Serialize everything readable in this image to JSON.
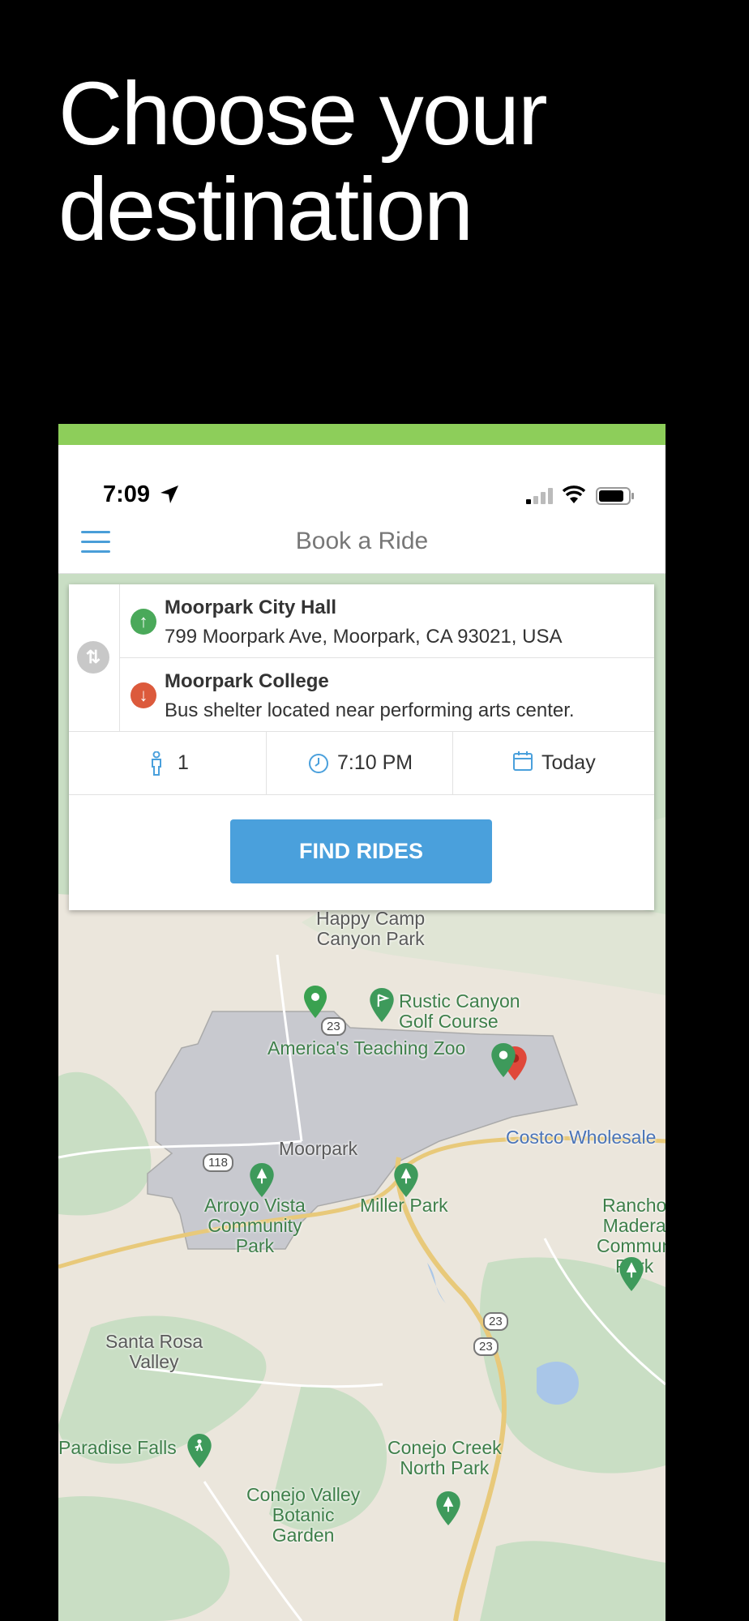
{
  "headline": {
    "line1": "Choose your",
    "line2": "destination"
  },
  "status_bar": {
    "time": "7:09"
  },
  "navbar": {
    "title": "Book a Ride"
  },
  "origin": {
    "name": "Moorpark City Hall",
    "address": "799 Moorpark Ave, Moorpark, CA 93021, USA"
  },
  "destination": {
    "name": "Moorpark College",
    "address": "Bus shelter located near performing arts center."
  },
  "options": {
    "passengers": "1",
    "time": "7:10 PM",
    "date": "Today"
  },
  "find_button": "FIND RIDES",
  "map": {
    "labels": {
      "happy_camp": "Happy Camp\nCanyon Park",
      "rustic": "Rustic Canyon\nGolf Course",
      "zoo": "America's Teaching Zoo",
      "moorpark": "Moorpark",
      "costco": "Costco Wholesale",
      "arroyo": "Arroyo Vista\nCommunity\nPark",
      "miller": "Miller Park",
      "rancho": "Rancho\nMadera\nCommun\nPark",
      "santa_rosa": "Santa Rosa\nValley",
      "paradise": "Paradise Falls",
      "conejo_creek": "Conejo Creek\nNorth Park",
      "conejo_valley": "Conejo Valley\nBotanic\nGarden"
    },
    "shields": {
      "s23a": "23",
      "s118": "118",
      "s23b": "23",
      "s23c": "23"
    }
  },
  "colors": {
    "accent_green": "#8dce5a",
    "button_blue": "#4aa0dc",
    "origin_green": "#4aa95a",
    "dest_red": "#dc5a3c"
  }
}
